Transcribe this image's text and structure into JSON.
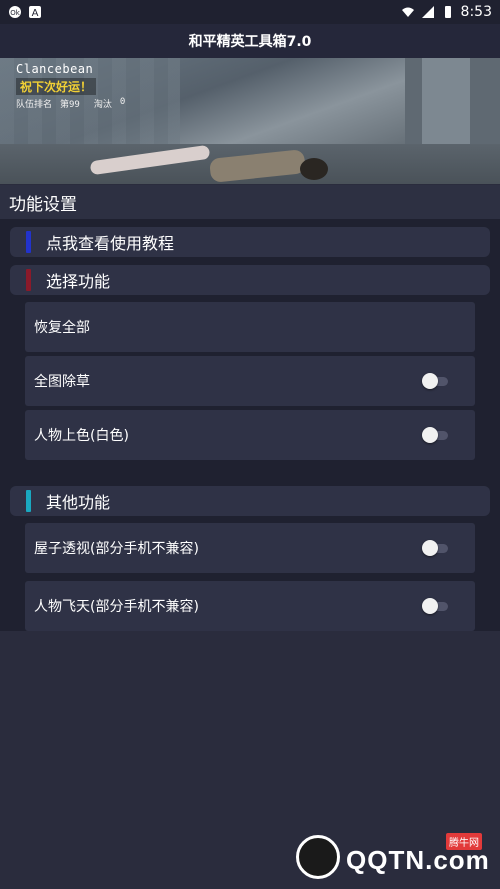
{
  "status_bar": {
    "time": "8:53",
    "left_icons": [
      "circle-notification-icon",
      "a-notification-icon"
    ],
    "right_icons": [
      "wifi-icon",
      "signal-icon",
      "battery-icon"
    ]
  },
  "app": {
    "title": "和平精英工具箱7.0"
  },
  "banner": {
    "player_name": "Clancebean",
    "cheer_text": "祝下次好运！",
    "rank_label": "队伍排名",
    "rank_value": "第99",
    "eliminated_label": "淘汰",
    "eliminated_value": "0"
  },
  "section": {
    "title": "功能设置"
  },
  "categories": [
    {
      "label": "点我查看使用教程",
      "color": "#2233cc"
    },
    {
      "label": "选择功能",
      "color": "#8a1a2a"
    },
    {
      "label": "其他功能",
      "color": "#1aa8c0"
    }
  ],
  "items": [
    {
      "label": "恢复全部",
      "has_toggle": false
    },
    {
      "label": "全图除草",
      "has_toggle": true,
      "on": false
    },
    {
      "label": "人物上色(白色)",
      "has_toggle": true,
      "on": false
    },
    {
      "label": "屋子透视(部分手机不兼容)",
      "has_toggle": true,
      "on": false
    },
    {
      "label": "人物飞天(部分手机不兼容)",
      "has_toggle": true,
      "on": false
    }
  ],
  "watermark": {
    "brand": "QQTN.com",
    "chinese": "腾牛网"
  }
}
